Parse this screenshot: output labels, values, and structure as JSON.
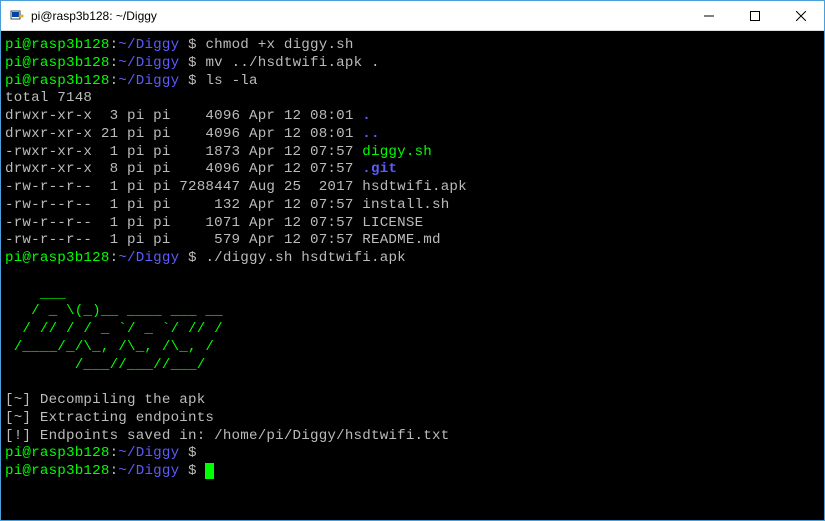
{
  "window": {
    "title": "pi@rasp3b128: ~/Diggy"
  },
  "prompt": {
    "user_host": "pi@rasp3b128",
    "sep": ":",
    "path": "~/Diggy",
    "sigil": " $ "
  },
  "commands": {
    "chmod": "chmod +x diggy.sh",
    "mv": "mv ../hsdtwifi.apk .",
    "ls": "ls -la",
    "run": "./diggy.sh hsdtwifi.apk"
  },
  "ls_output": {
    "total": "total 7148",
    "rows": [
      {
        "perm": "drwxr-xr-x",
        "links": "3",
        "own": "pi pi",
        "size": "4096",
        "date": "Apr 12 08:01",
        "name": ".",
        "cls": "blue-b"
      },
      {
        "perm": "drwxr-xr-x",
        "links": "21",
        "own": "pi pi",
        "size": "4096",
        "date": "Apr 12 08:01",
        "name": "..",
        "cls": "blue-b"
      },
      {
        "perm": "-rwxr-xr-x",
        "links": "1",
        "own": "pi pi",
        "size": "1873",
        "date": "Apr 12 07:57",
        "name": "diggy.sh",
        "cls": "green"
      },
      {
        "perm": "drwxr-xr-x",
        "links": "8",
        "own": "pi pi",
        "size": "4096",
        "date": "Apr 12 07:57",
        "name": ".git",
        "cls": "blue-b"
      },
      {
        "perm": "-rw-r--r--",
        "links": "1",
        "own": "pi pi",
        "size": "7288447",
        "date": "Aug 25  2017",
        "name": "hsdtwifi.apk",
        "cls": "gray"
      },
      {
        "perm": "-rw-r--r--",
        "links": "1",
        "own": "pi pi",
        "size": "132",
        "date": "Apr 12 07:57",
        "name": "install.sh",
        "cls": "gray"
      },
      {
        "perm": "-rw-r--r--",
        "links": "1",
        "own": "pi pi",
        "size": "1071",
        "date": "Apr 12 07:57",
        "name": "LICENSE",
        "cls": "gray"
      },
      {
        "perm": "-rw-r--r--",
        "links": "1",
        "own": "pi pi",
        "size": "579",
        "date": "Apr 12 07:57",
        "name": "README.md",
        "cls": "gray"
      }
    ]
  },
  "ascii_art": [
    "    ___                 ",
    "   / _ \\(_)__ ____ ___ __",
    "  / // / / _ `/ _ `/ // /",
    " /____/_/\\_, /\\_, /\\_, / ",
    "        /___//___//___/  "
  ],
  "messages": {
    "decompile": "[~] Decompiling the apk",
    "extract": "[~] Extracting endpoints",
    "saved": "[!] Endpoints saved in: /home/pi/Diggy/hsdtwifi.txt"
  }
}
